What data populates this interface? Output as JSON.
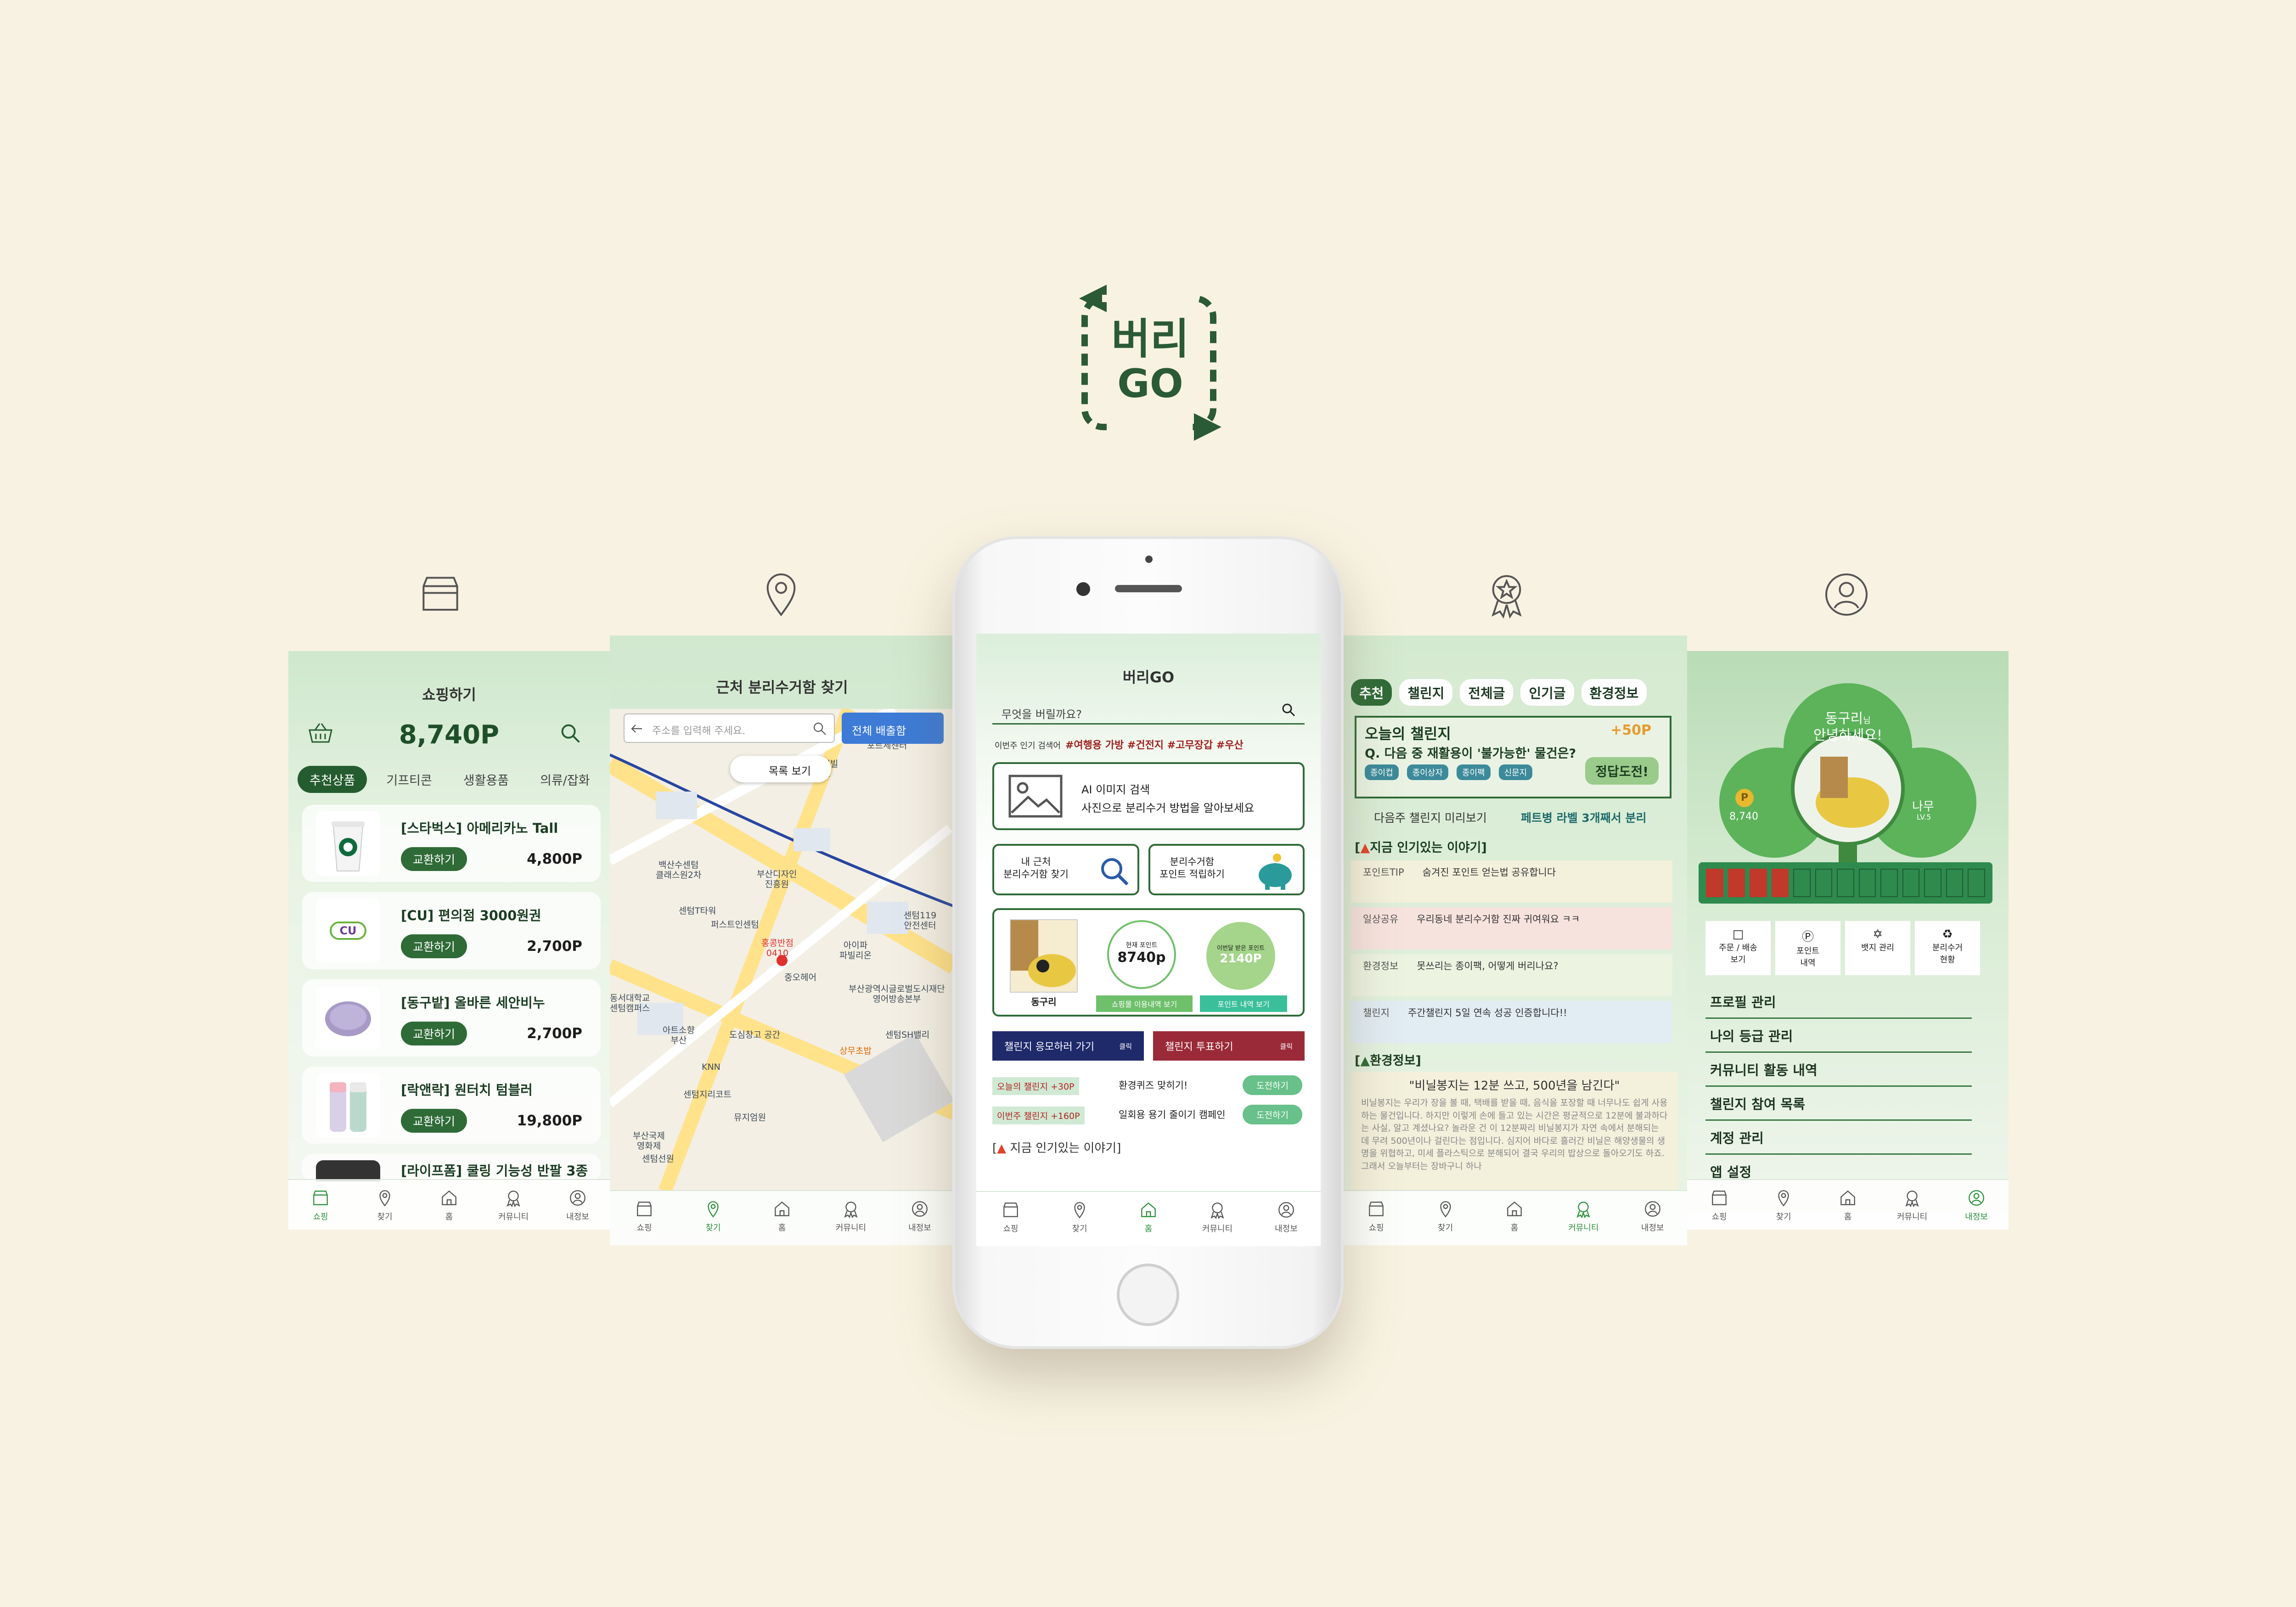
{
  "brand": {
    "logo_line1": "버리",
    "logo_line2": "GO",
    "color": "#2b5a36"
  },
  "colors": {
    "background": "#f8f2e2",
    "primary": "#2f6b37",
    "accent_red": "#a02020"
  },
  "tabbar": {
    "shop": "쇼핑",
    "find": "찾기",
    "home": "홈",
    "community": "커뮤니티",
    "my": "내정보"
  },
  "shop": {
    "title": "쇼핑하기",
    "points": "8,740P",
    "categories": [
      "추천상품",
      "기프티콘",
      "생활용품",
      "의류/잡화"
    ],
    "exchange_label": "교환하기",
    "products": [
      {
        "name": "[스타벅스] 아메리카노 Tall",
        "price": "4,800P"
      },
      {
        "name": "[CU] 편의점 3000원권",
        "price": "2,700P"
      },
      {
        "name": "[동구밭] 올바른 세안비누",
        "price": "2,700P"
      },
      {
        "name": "[락앤락] 원터치 텀블러",
        "price": "19,800P"
      },
      {
        "name": "[라이프폼] 쿨링 기능성 반팔 3종",
        "price": ""
      }
    ],
    "cu_logo": "CU"
  },
  "map": {
    "title": "근처 분리수거함 찾기",
    "search_placeholder": "주소를 입력해 주세요.",
    "all_bins": "전체 배출함",
    "list_view": "목록 보기",
    "places": [
      "포르세센터",
      "센텀센시빌\n아파트",
      "백산수센텀\n클래스원2차",
      "부산디자인\n진흥원",
      "센텀T타워",
      "퍼스트인센텀",
      "홍콩반점\n0410",
      "중오헤어",
      "아이파\n파빌리온",
      "센텀119\n안전센터",
      "부산광역시글로벌도시재단\n영어방송본부",
      "동서대학교\n센텀캠퍼스",
      "아트소향\n부산",
      "도심창고 공간",
      "센텀SH밸리",
      "KNN",
      "상무초밥",
      "센텀지리코트",
      "뮤지엄원",
      "부산국제\n영화제",
      "센텀선원"
    ]
  },
  "home": {
    "title": "버리GO",
    "search_placeholder": "무엇을 버릴까요?",
    "hot_label": "이번주 인기 검색어",
    "hot_tags": "#여행용 가방  #건전지  #고무장갑  #우산",
    "ai_title": "AI 이미지 검색",
    "ai_desc": "사진으로 분리수거 방법을 알아보세요",
    "nearby": "내 근처\n분리수거함 찾기",
    "savepoint": "분리수거함\n포인트 적립하기",
    "char_name": "동구리",
    "cur_point_label": "현재 포인트",
    "cur_point": "8740p",
    "monthly_label": "이번달 받은 포인트",
    "monthly_point": "2140P",
    "shop_history": "쇼핑몰 이용내역 보기",
    "point_history": "포인트 내역 보기",
    "go_challenge": "챌린지 응모하러 가기",
    "vote_challenge": "챌린지 투표하기",
    "click": "클릭",
    "rows": [
      {
        "label": "오늘의 챌린지 +30P",
        "text": "환경퀴즈 맞히기!",
        "btn": "도전하기"
      },
      {
        "label": "이번주 챌린지 +160P",
        "text": "일회용 용기 줄이기 캠페인",
        "btn": "도전하기"
      }
    ],
    "popular": "지금 인기있는 이야기"
  },
  "community": {
    "tabs": [
      "추천",
      "챌린지",
      "전체글",
      "인기글",
      "환경정보"
    ],
    "today_challenge": "오늘의 챌린지",
    "reward": "+50P",
    "question": "Q. 다음 중 재활용이 '불가능한' 물건은?",
    "options": [
      "종이컵",
      "종이상자",
      "종이팩",
      "신문지"
    ],
    "answer_btn": "정답도전!",
    "next_preview": "다음주 챌린지 미리보기",
    "next_title": "페트병 라벨 3개째서 분리",
    "popular": "지금 인기있는 이야기",
    "stories": [
      {
        "cat": "포인트TIP",
        "title": "숨겨진 포인트 얻는법 공유합니다"
      },
      {
        "cat": "일상공유",
        "title": "우리동네 분리수거함 진짜 귀여워요 ㅋㅋ"
      },
      {
        "cat": "환경정보",
        "title": "못쓰리는 종이팩, 어떻게 버리나요?"
      },
      {
        "cat": "챌린지",
        "title": "주간챌린지 5일 연속 성공 인증합니다!!"
      }
    ],
    "env_info": "환경정보",
    "quote": "\"비닐봉지는 12분 쓰고, 500년을 남긴다\"",
    "quote_body": "비닐봉지는 우리가 장을 볼 때, 택배를 받을 때, 음식을 포장할 때 너무나도 쉽게 사용하는 물건입니다. 하지만 이렇게 손에 들고 있는 시간은 평균적으로 12분에 불과하다는 사실, 알고 계셨나요? 놀라운 건 이 12분짜리 비닐봉지가 자연 속에서 분해되는 데 무려 500년이나 걸린다는 점입니다. 심지어 바다로 흘러간 비닐은 해양생물의 생명을 위협하고, 미세 플라스틱으로 분해되어 결국 우리의 밥상으로 돌아오기도 하죠. 그래서 오늘부터는 장바구니 하나"
  },
  "profile": {
    "greeting_name": "동구리",
    "greeting_suffix": "님",
    "greeting": "안녕하세요!",
    "points": "8,740",
    "tree_name": "나무",
    "level": "LV.5",
    "quick": [
      "주문 / 배송\n보기",
      "포인트\n내역",
      "뱃지 관리",
      "분리수거\n현황"
    ],
    "menus": [
      "프로필 관리",
      "나의 등급 관리",
      "커뮤니티 활동 내역",
      "챌린지 참여 목록",
      "계정 관리",
      "앱 설정"
    ]
  }
}
